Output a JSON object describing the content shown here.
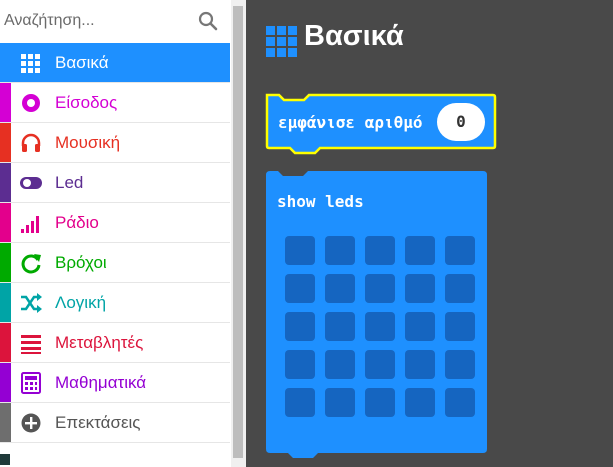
{
  "search": {
    "placeholder": "Αναζήτηση..."
  },
  "categories": [
    {
      "label": "Βασικά",
      "color": "#1e90ff",
      "icon": "grid-icon",
      "selected": true
    },
    {
      "label": "Είσοδος",
      "color": "#d400d4",
      "icon": "record-icon"
    },
    {
      "label": "Μουσική",
      "color": "#e63022",
      "icon": "headphones-icon"
    },
    {
      "label": "Led",
      "color": "#5c2d91",
      "icon": "toggle-icon"
    },
    {
      "label": "Ράδιο",
      "color": "#e3008c",
      "icon": "signal-bars-icon"
    },
    {
      "label": "Βρόχοι",
      "color": "#00aa00",
      "icon": "refresh-icon"
    },
    {
      "label": "Λογική",
      "color": "#00a4a6",
      "icon": "shuffle-icon"
    },
    {
      "label": "Μεταβλητές",
      "color": "#dc143c",
      "icon": "list-lines-icon"
    },
    {
      "label": "Μαθηματικά",
      "color": "#9400d3",
      "icon": "calculator-icon"
    },
    {
      "label": "Επεκτάσεις",
      "color": "#6e6e6e",
      "icon": "plus-circle-icon"
    }
  ],
  "flyout": {
    "title": "Βασικά",
    "title_icon": "grid-icon",
    "blocks": {
      "show_number": {
        "label": "εμφάνισε αριθμό",
        "value": "0"
      },
      "show_leds": {
        "label": "show leds",
        "rows": 5,
        "cols": 5
      }
    }
  },
  "colors": {
    "workspace": "#494949",
    "block_basic": "#1e90ff",
    "block_highlight": "#ffff00",
    "led_off": "#1565c0"
  }
}
